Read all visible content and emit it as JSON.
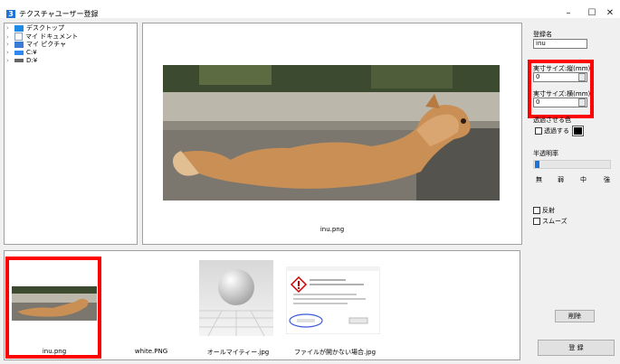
{
  "window": {
    "icon_char": "3",
    "title": "テクスチャユーザー登録",
    "minimize": "–",
    "maximize": "☐",
    "close": "✕"
  },
  "tree": {
    "items": [
      {
        "label": "デスクトップ",
        "icon": "desktop-icon",
        "color": "#1e8ae8"
      },
      {
        "label": "マイ ドキュメント",
        "icon": "documents-icon",
        "color": "#8a9bb4"
      },
      {
        "label": "マイ ピクチャ",
        "icon": "pictures-icon",
        "color": "#3a7bd5"
      },
      {
        "label": "C:¥",
        "icon": "drive-icon",
        "color": "#2d89ef"
      },
      {
        "label": "D:¥",
        "icon": "drive-icon",
        "color": "#666666"
      }
    ]
  },
  "preview": {
    "filename": "inu.png"
  },
  "properties": {
    "name_label": "登録名",
    "name_value": "inu",
    "height_label": "実寸サイズ:縦(mm)",
    "height_value": "0",
    "width_label": "実寸サイズ:横(mm)",
    "width_value": "0",
    "transparent_color_label": "透過させる色",
    "transparent_checkbox_label": "透過する",
    "transparent_color": "#000000",
    "opacity_label": "半透明率",
    "opacity_ticks": [
      "無",
      "弱",
      "中",
      "強"
    ],
    "opacity_level": 0,
    "reflect_label": "反射",
    "smooth_label": "スムーズ",
    "delete_button": "削除",
    "register_button": "登 録"
  },
  "gallery": {
    "items": [
      {
        "caption": "inu.png",
        "selected": true
      },
      {
        "caption": "white.PNG",
        "selected": false
      },
      {
        "caption": "オールマイティー.jpg",
        "selected": false
      },
      {
        "caption": "ファイルが開かない場合.jpg",
        "selected": false
      }
    ]
  },
  "colors": {
    "highlight": "#ff0000",
    "frame": "#f0f0f0"
  }
}
